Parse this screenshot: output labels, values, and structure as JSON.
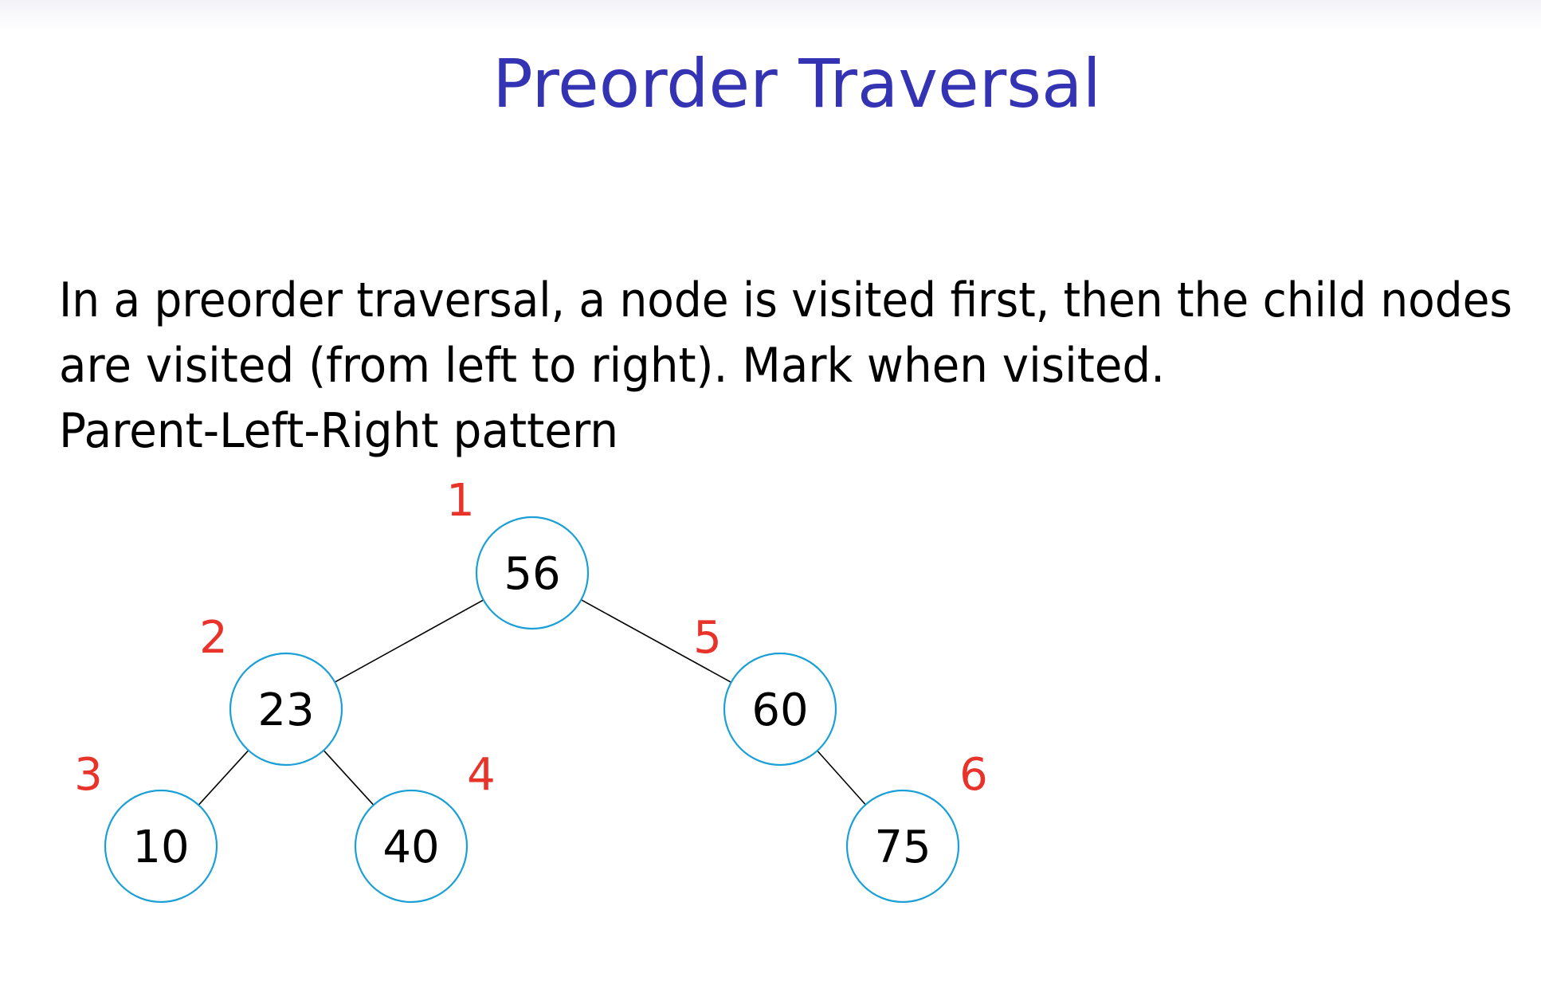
{
  "slide": {
    "title": "Preorder Traversal",
    "body_lines": [
      "In a preorder traversal, a node is visited first, then the child nodes",
      "are visited (from left to right). Mark when visited.",
      "Parent-Left-Right pattern"
    ]
  },
  "tree": {
    "nodes": [
      {
        "id": "n56",
        "value": "56",
        "visit_order": "1"
      },
      {
        "id": "n23",
        "value": "23",
        "visit_order": "2"
      },
      {
        "id": "n10",
        "value": "10",
        "visit_order": "3"
      },
      {
        "id": "n40",
        "value": "40",
        "visit_order": "4"
      },
      {
        "id": "n60",
        "value": "60",
        "visit_order": "5"
      },
      {
        "id": "n75",
        "value": "75",
        "visit_order": "6"
      }
    ],
    "edges": [
      [
        "n56",
        "n23"
      ],
      [
        "n56",
        "n60"
      ],
      [
        "n23",
        "n10"
      ],
      [
        "n23",
        "n40"
      ],
      [
        "n60",
        "n75"
      ]
    ],
    "colors": {
      "node_border": "#1a9fd6",
      "visit_order": "#e8332a",
      "title": "#3333b3"
    }
  }
}
